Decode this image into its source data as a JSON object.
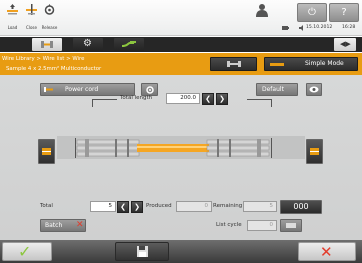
{
  "toolbar": {
    "buttons": [
      {
        "label": "Load"
      },
      {
        "label": "Close"
      },
      {
        "label": "Release"
      }
    ],
    "date": "15.10.2012",
    "time": "16:28"
  },
  "breadcrumb": {
    "path": "Wire Library > Wire list > Wire",
    "sample": "Sample 4 x 2.5mm² Multiconductor",
    "mode_button": "Simple Mode"
  },
  "wire": {
    "name": "Power cord",
    "default_button": "Default",
    "total_length_label": "Total length",
    "total_length_value": "200.0"
  },
  "production": {
    "total_label": "Total",
    "total_value": "5",
    "produced_label": "Produced",
    "produced_value": "0",
    "remaining_label": "Remaining",
    "remaining_value": "5",
    "counter_value": "000",
    "batch_label": "Batch",
    "list_cycle_label": "List cycle",
    "list_cycle_value": "0"
  },
  "colors": {
    "accent": "#e89c12",
    "confirm": "#8cc63f",
    "cancel": "#e23c2c"
  },
  "icons": [
    "load-icon",
    "close-icon",
    "release-icon",
    "user-icon",
    "power-icon",
    "help-icon",
    "battery-icon",
    "speaker-icon",
    "left-right-icon",
    "cable-icon",
    "gear-icon",
    "green-cable-icon",
    "eye-icon",
    "save-icon",
    "checkmark-icon",
    "cancel-icon"
  ]
}
